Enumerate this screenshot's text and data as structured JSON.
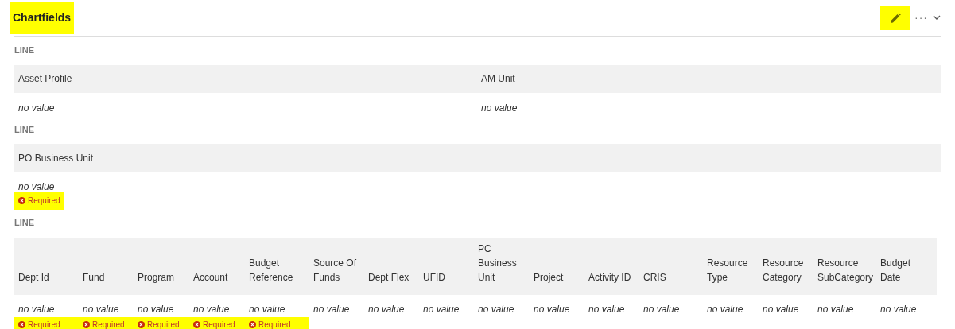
{
  "header": {
    "title": "Chartfields",
    "title_highlighted": true,
    "edit_highlighted": true,
    "more": "···"
  },
  "sections": [
    {
      "label": "LINE",
      "kind": "pair",
      "fields": [
        {
          "label": "Asset Profile",
          "value": "no value"
        },
        {
          "label": "AM Unit",
          "value": "no value"
        }
      ]
    },
    {
      "label": "LINE",
      "kind": "pair",
      "fields": [
        {
          "label": "PO Business Unit",
          "value": "no value",
          "required": true,
          "highlighted": true,
          "required_text": "Required"
        }
      ]
    },
    {
      "label": "LINE",
      "kind": "grid",
      "fields": [
        {
          "label": "Dept Id",
          "value": "no value",
          "required": true,
          "highlighted": true,
          "required_text": "Required"
        },
        {
          "label": "Fund",
          "value": "no value",
          "required": true,
          "highlighted": true,
          "required_text": "Required"
        },
        {
          "label": "Program",
          "value": "no value",
          "required": true,
          "highlighted": true,
          "required_text": "Required"
        },
        {
          "label": "Account",
          "value": "no value",
          "required": true,
          "highlighted": true,
          "required_text": "Required"
        },
        {
          "label": "Budget Reference",
          "value": "no value",
          "required": true,
          "highlighted": true,
          "required_text": "Required"
        },
        {
          "label": "Source Of Funds",
          "value": "no value"
        },
        {
          "label": "Dept Flex",
          "value": "no value"
        },
        {
          "label": "UFID",
          "value": "no value"
        },
        {
          "label": "PC Business Unit",
          "value": "no value"
        },
        {
          "label": "Project",
          "value": "no value"
        },
        {
          "label": "Activity ID",
          "value": "no value"
        },
        {
          "label": "CRIS",
          "value": "no value"
        },
        {
          "label": "Resource Type",
          "value": "no value"
        },
        {
          "label": "Resource Category",
          "value": "no value"
        },
        {
          "label": "Resource SubCategory",
          "value": "no value"
        },
        {
          "label": "Budget Date",
          "value": "no value"
        }
      ]
    }
  ]
}
